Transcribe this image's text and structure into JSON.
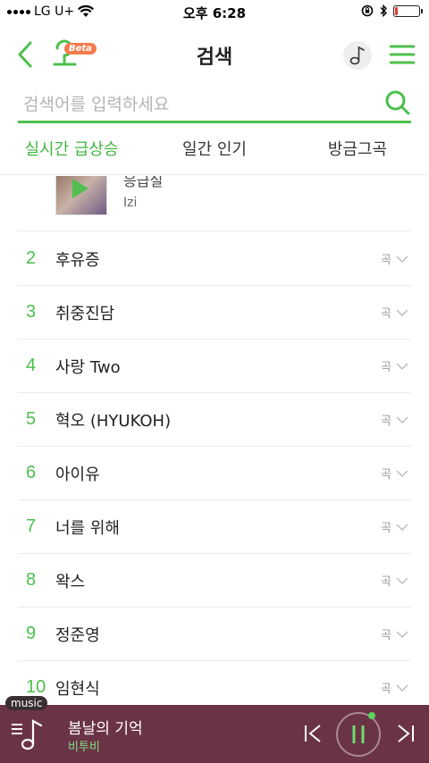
{
  "status_bar": {
    "carrier": "LG U+",
    "time": "오후 6:28"
  },
  "header": {
    "title": "검색",
    "logo_badge": "Beta"
  },
  "search": {
    "placeholder": "검색어를 입력하세요",
    "value": ""
  },
  "tabs": [
    {
      "label": "실시간 급상승",
      "active": true
    },
    {
      "label": "일간 인기",
      "active": false
    },
    {
      "label": "방금그곡",
      "active": false
    }
  ],
  "partial_item": {
    "title": "응급실",
    "artist": "Izi"
  },
  "ranking": [
    {
      "rank": "2",
      "keyword": "후유증",
      "type": "곡"
    },
    {
      "rank": "3",
      "keyword": "취중진담",
      "type": "곡"
    },
    {
      "rank": "4",
      "keyword": "사랑 Two",
      "type": "곡"
    },
    {
      "rank": "5",
      "keyword": "혁오 (HYUKOH)",
      "type": "곡"
    },
    {
      "rank": "6",
      "keyword": "아이유",
      "type": "곡"
    },
    {
      "rank": "7",
      "keyword": "너를 위해",
      "type": "곡"
    },
    {
      "rank": "8",
      "keyword": "왁스",
      "type": "곡"
    },
    {
      "rank": "9",
      "keyword": "정준영",
      "type": "곡"
    },
    {
      "rank": "10",
      "keyword": "임현식",
      "type": "곡"
    }
  ],
  "player": {
    "tag": "music",
    "song_title": "봄날의 기억",
    "artist": "비투비"
  },
  "colors": {
    "accent_green": "#4cc04c",
    "player_bg": "#6b3346",
    "battery_low": "#e53935"
  },
  "icons": {
    "back": "chevron-left-icon",
    "note": "music-note-icon",
    "menu": "hamburger-menu-icon",
    "search": "search-icon",
    "expand": "chevron-down-icon",
    "prev": "skip-previous-icon",
    "pause": "pause-icon",
    "next": "skip-next-icon"
  }
}
